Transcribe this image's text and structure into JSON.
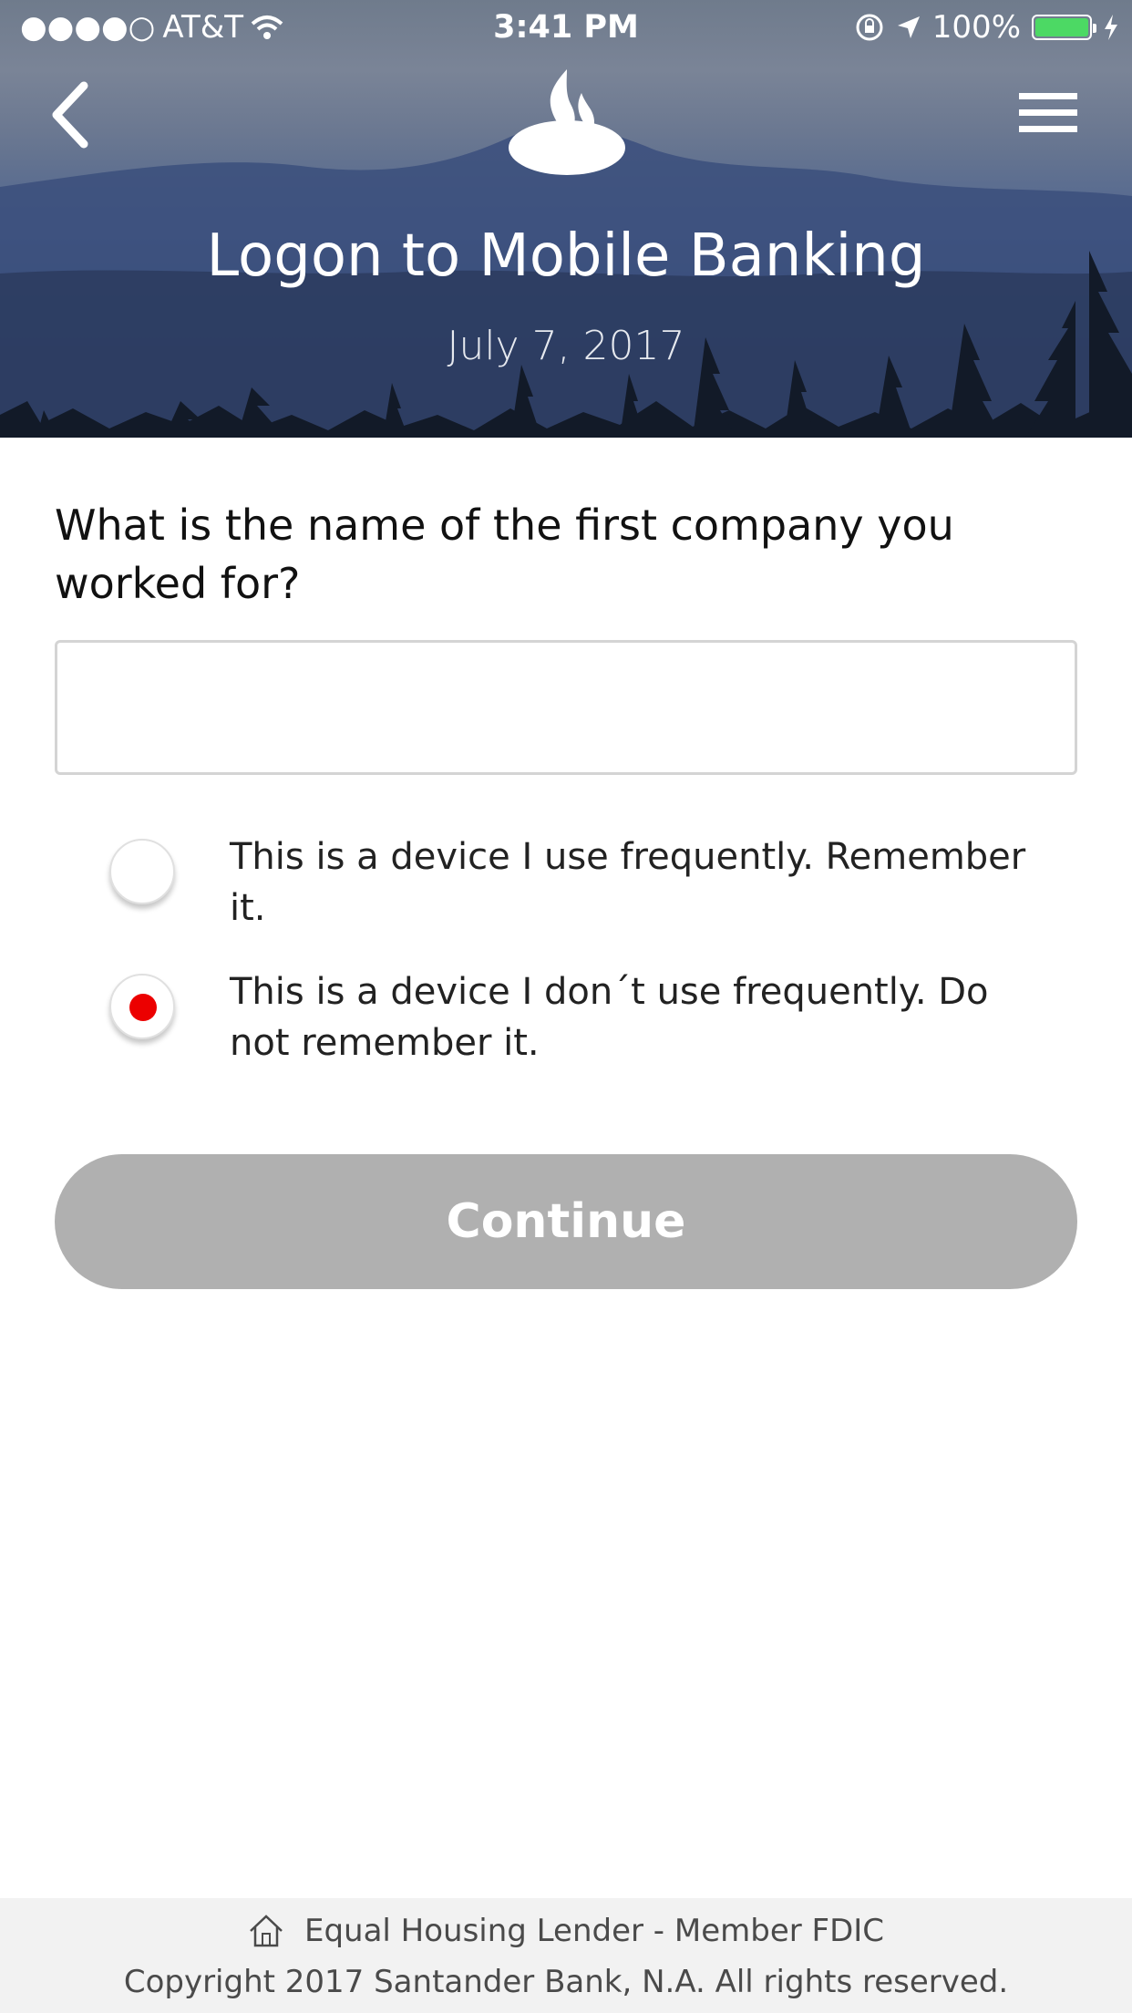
{
  "status_bar": {
    "signal": "●●●●○",
    "carrier": "AT&T",
    "time": "3:41 PM",
    "battery_percent": "100%",
    "battery_level": 1.0,
    "battery_color": "#4cd964"
  },
  "header": {
    "title": "Logon to Mobile Banking",
    "date": "July 7, 2017",
    "back_icon": "chevron-left-icon",
    "menu_icon": "hamburger-menu-icon",
    "logo_icon": "santander-flame-logo"
  },
  "form": {
    "question": "What is the name of the first company you worked for?",
    "answer_value": "",
    "answer_placeholder": "",
    "options": [
      {
        "label": "This is a device I use frequently. Remember it.",
        "selected": false
      },
      {
        "label": "This is a device I don´t use frequently. Do not remember it.",
        "selected": true
      }
    ],
    "continue_label": "Continue",
    "continue_color": "#b0b0b0",
    "selected_color": "#ec0000"
  },
  "footer": {
    "line1": "Equal Housing Lender - Member FDIC",
    "line2": "Copyright 2017 Santander Bank, N.A. All rights reserved.",
    "icon": "house-icon"
  }
}
